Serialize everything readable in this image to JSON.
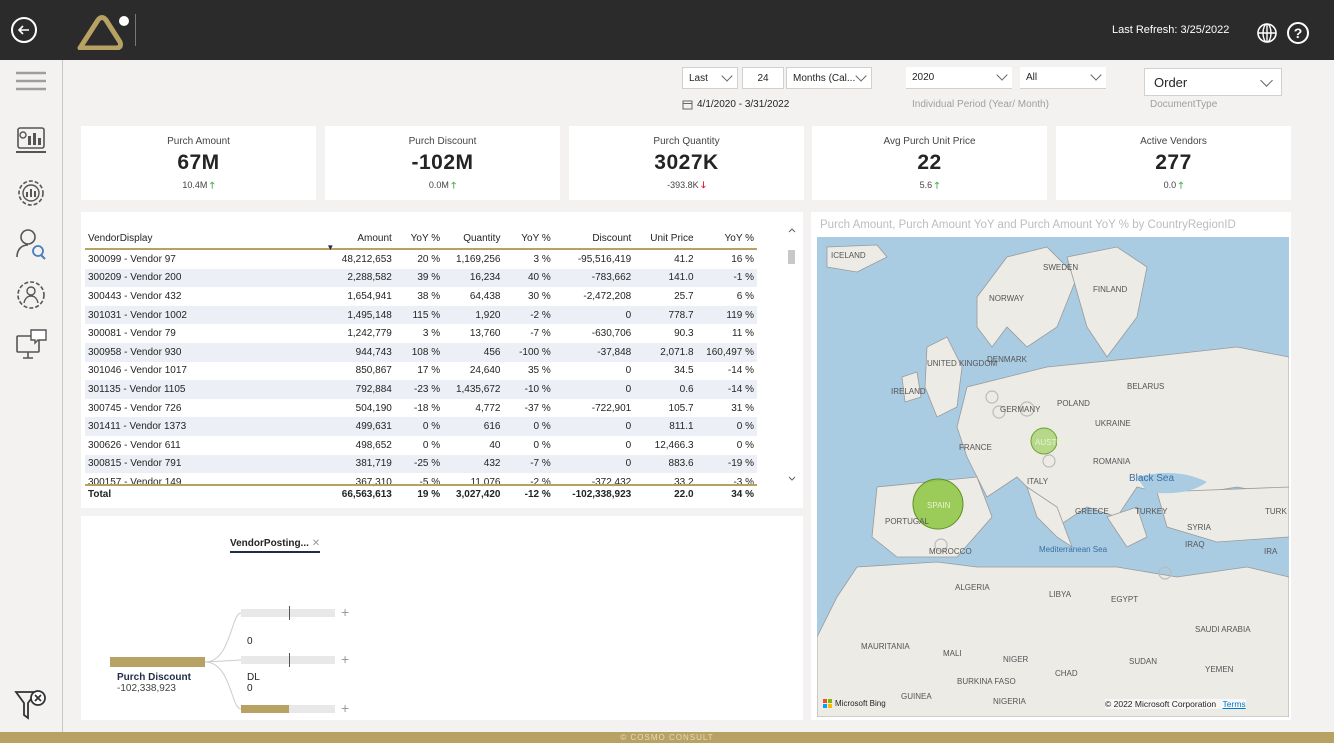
{
  "app": {
    "last_refresh": "Last Refresh: 3/25/2022",
    "footer": "© COSMO CONSULT"
  },
  "colors": {
    "accent": "#b7a163",
    "topbar": "#2b2b2b",
    "kpi_up": "#4caf50",
    "kpi_down": "#e81123",
    "map_bubble": "#8dc63f"
  },
  "sidebar": {
    "icons": [
      "hamburger-menu-icon",
      "dashboard-icon",
      "settings-chart-icon",
      "user-search-icon",
      "user-settings-icon",
      "monitor-chat-icon",
      "clear-filter-icon"
    ]
  },
  "filters": {
    "relative": {
      "mode": "Last",
      "count": "24",
      "unit": "Months (Cal...",
      "range": "4/1/2020 - 3/31/2022"
    },
    "period": {
      "year": "2020",
      "month": "All",
      "label": "Individual Period (Year/ Month)"
    },
    "document_type": {
      "value": "Order",
      "label": "DocumentType"
    }
  },
  "kpis": [
    {
      "title": "Purch Amount",
      "value": "67M",
      "delta": "10.4M",
      "trend": "up"
    },
    {
      "title": "Purch Discount",
      "value": "-102M",
      "delta": "0.0M",
      "trend": "up"
    },
    {
      "title": "Purch Quantity",
      "value": "3027K",
      "delta": "-393.8K",
      "trend": "down"
    },
    {
      "title": "Avg Purch Unit Price",
      "value": "22",
      "delta": "5.6",
      "trend": "up"
    },
    {
      "title": "Active Vendors",
      "value": "277",
      "delta": "0.0",
      "trend": "up"
    }
  ],
  "table": {
    "headers": [
      "VendorDisplay",
      "Amount",
      "YoY %",
      "Quantity",
      "YoY %",
      "Discount",
      "Unit Price",
      "YoY %"
    ],
    "rows": [
      [
        "300099 - Vendor 97",
        "48,212,653",
        "20 %",
        "1,169,256",
        "3 %",
        "-95,516,419",
        "41.2",
        "16 %"
      ],
      [
        "300209 - Vendor 200",
        "2,288,582",
        "39 %",
        "16,234",
        "40 %",
        "-783,662",
        "141.0",
        "-1 %"
      ],
      [
        "300443 - Vendor 432",
        "1,654,941",
        "38 %",
        "64,438",
        "30 %",
        "-2,472,208",
        "25.7",
        "6 %"
      ],
      [
        "301031 - Vendor 1002",
        "1,495,148",
        "115 %",
        "1,920",
        "-2 %",
        "0",
        "778.7",
        "119 %"
      ],
      [
        "300081 - Vendor 79",
        "1,242,779",
        "3 %",
        "13,760",
        "-7 %",
        "-630,706",
        "90.3",
        "11 %"
      ],
      [
        "300958 - Vendor 930",
        "944,743",
        "108 %",
        "456",
        "-100 %",
        "-37,848",
        "2,071.8",
        "160,497 %"
      ],
      [
        "301046 - Vendor 1017",
        "850,867",
        "17 %",
        "24,640",
        "35 %",
        "0",
        "34.5",
        "-14 %"
      ],
      [
        "301135 - Vendor 1105",
        "792,884",
        "-23 %",
        "1,435,672",
        "-10 %",
        "0",
        "0.6",
        "-14 %"
      ],
      [
        "300745 - Vendor 726",
        "504,190",
        "-18 %",
        "4,772",
        "-37 %",
        "-722,901",
        "105.7",
        "31 %"
      ],
      [
        "301411 - Vendor 1373",
        "499,631",
        "0 %",
        "616",
        "0 %",
        "0",
        "811.1",
        "0 %"
      ],
      [
        "300626 - Vendor 611",
        "498,652",
        "0 %",
        "40",
        "0 %",
        "0",
        "12,466.3",
        "0 %"
      ],
      [
        "300815 - Vendor 791",
        "381,719",
        "-25 %",
        "432",
        "-7 %",
        "0",
        "883.6",
        "-19 %"
      ],
      [
        "300157 - Vendor 149",
        "367,310",
        "-5 %",
        "11,076",
        "-2 %",
        "-372,432",
        "33.2",
        "-3 %"
      ]
    ],
    "total": [
      "Total",
      "66,563,613",
      "19 %",
      "3,027,420",
      "-12 %",
      "-102,338,923",
      "22.0",
      "34 %"
    ]
  },
  "decomposition": {
    "header": "VendorPosting...",
    "root_label": "Purch Discount",
    "root_value": "-102,338,923",
    "branches": [
      "0",
      "DL",
      "0"
    ]
  },
  "map": {
    "title": "Purch Amount, Purch Amount YoY and Purch Amount YoY % by CountryRegionID",
    "labels": [
      "ICELAND",
      "SWEDEN",
      "FINLAND",
      "NORWAY",
      "UNITED KINGDOM",
      "DENMARK",
      "IRELAND",
      "BELARUS",
      "POLAND",
      "GERMANY",
      "UKRAINE",
      "FRANCE",
      "AUSTRIA",
      "ROMANIA",
      "Black Sea",
      "ITALY",
      "SPAIN",
      "PORTUGAL",
      "GREECE",
      "TURKEY",
      "SYRIA",
      "IRAQ",
      "IRA",
      "TURK",
      "MOROCCO",
      "Mediterranean Sea",
      "ALGERIA",
      "LIBYA",
      "EGYPT",
      "SAUDI ARABIA",
      "MAURITANIA",
      "MALI",
      "NIGER",
      "CHAD",
      "SUDAN",
      "YEMEN",
      "BURKINA FASO",
      "GUINEA",
      "NIGERIA"
    ],
    "attribution": "© 2022 Microsoft Corporation",
    "terms": "Terms",
    "bing": "Microsoft Bing"
  }
}
